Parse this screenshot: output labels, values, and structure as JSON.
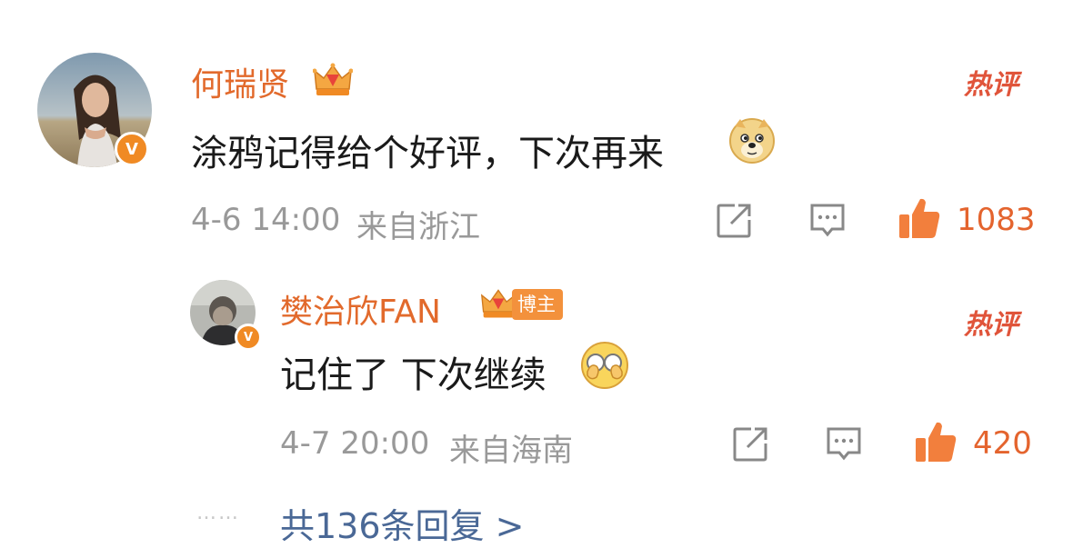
{
  "colors": {
    "name": "#e26a2c",
    "hot": "#e0543a",
    "text": "#1a1a1a",
    "meta": "#999999",
    "like": "#e4642e",
    "badge": "#f08a24",
    "link": "#4a6896"
  },
  "comment": {
    "author": "何瑞贤",
    "verified_badge": "V",
    "hot_label": "热评",
    "text": "涂鸦记得给个好评，下次再来",
    "emoji": "doge-emoji",
    "time": "4-6 14:00",
    "location": "来自浙江",
    "likes": "1083",
    "icons": [
      "crown-icon",
      "share-icon",
      "comment-icon",
      "like-icon"
    ]
  },
  "reply": {
    "author": "樊治欣FAN",
    "verified_badge": "V",
    "author_tag": "博主",
    "hot_label": "热评",
    "text": "记住了 下次继续",
    "emoji": "cover-face-emoji",
    "time": "4-7 20:00",
    "location": "来自海南",
    "likes": "420",
    "icons": [
      "crown-icon",
      "share-icon",
      "comment-icon",
      "like-icon"
    ]
  },
  "footer": {
    "dots": "……",
    "more_replies": "共136条回复 >"
  }
}
